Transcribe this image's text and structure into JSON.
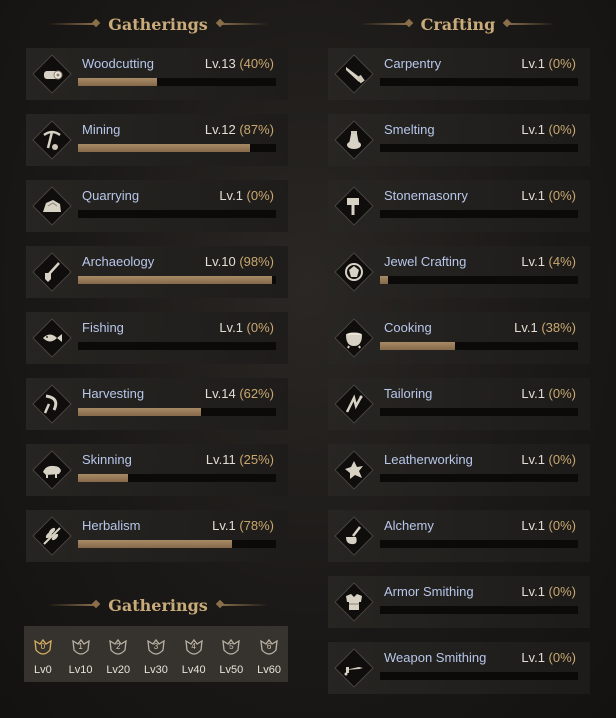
{
  "gatherings_title": "Gatherings",
  "crafting_title": "Crafting",
  "gatherings_bottom_title": "Gatherings",
  "gathering_skills": [
    {
      "name": "Woodcutting",
      "level": "Lv.13",
      "pct": "(40%)",
      "progress": 0.4,
      "icon": "log-icon"
    },
    {
      "name": "Mining",
      "level": "Lv.12",
      "pct": "(87%)",
      "progress": 0.87,
      "icon": "pickaxe-icon"
    },
    {
      "name": "Quarrying",
      "level": "Lv.1",
      "pct": "(0%)",
      "progress": 0.0,
      "icon": "stone-icon"
    },
    {
      "name": "Archaeology",
      "level": "Lv.10",
      "pct": "(98%)",
      "progress": 0.98,
      "icon": "shovel-icon"
    },
    {
      "name": "Fishing",
      "level": "Lv.1",
      "pct": "(0%)",
      "progress": 0.0,
      "icon": "fish-icon"
    },
    {
      "name": "Harvesting",
      "level": "Lv.14",
      "pct": "(62%)",
      "progress": 0.62,
      "icon": "sickle-icon"
    },
    {
      "name": "Skinning",
      "level": "Lv.11",
      "pct": "(25%)",
      "progress": 0.25,
      "icon": "boar-icon"
    },
    {
      "name": "Herbalism",
      "level": "Lv.1",
      "pct": "(78%)",
      "progress": 0.78,
      "icon": "herb-icon"
    }
  ],
  "crafting_skills": [
    {
      "name": "Carpentry",
      "level": "Lv.1",
      "pct": "(0%)",
      "progress": 0.0,
      "icon": "saw-icon"
    },
    {
      "name": "Smelting",
      "level": "Lv.1",
      "pct": "(0%)",
      "progress": 0.0,
      "icon": "furnace-icon"
    },
    {
      "name": "Stonemasonry",
      "level": "Lv.1",
      "pct": "(0%)",
      "progress": 0.0,
      "icon": "hammer-icon"
    },
    {
      "name": "Jewel Crafting",
      "level": "Lv.1",
      "pct": "(4%)",
      "progress": 0.04,
      "icon": "gem-icon"
    },
    {
      "name": "Cooking",
      "level": "Lv.1",
      "pct": "(38%)",
      "progress": 0.38,
      "icon": "pot-icon"
    },
    {
      "name": "Tailoring",
      "level": "Lv.1",
      "pct": "(0%)",
      "progress": 0.0,
      "icon": "needle-icon"
    },
    {
      "name": "Leatherworking",
      "level": "Lv.1",
      "pct": "(0%)",
      "progress": 0.0,
      "icon": "hide-icon"
    },
    {
      "name": "Alchemy",
      "level": "Lv.1",
      "pct": "(0%)",
      "progress": 0.0,
      "icon": "flask-icon"
    },
    {
      "name": "Armor Smithing",
      "level": "Lv.1",
      "pct": "(0%)",
      "progress": 0.0,
      "icon": "armor-icon"
    },
    {
      "name": "Weapon Smithing",
      "level": "Lv.1",
      "pct": "(0%)",
      "progress": 0.0,
      "icon": "sword-icon"
    }
  ],
  "tiers": [
    {
      "badge": "0",
      "label": "Lv0",
      "active": true
    },
    {
      "badge": "1",
      "label": "Lv10",
      "active": false
    },
    {
      "badge": "2",
      "label": "Lv20",
      "active": false
    },
    {
      "badge": "3",
      "label": "Lv30",
      "active": false
    },
    {
      "badge": "4",
      "label": "Lv40",
      "active": false
    },
    {
      "badge": "5",
      "label": "Lv50",
      "active": false
    },
    {
      "badge": "6",
      "label": "Lv60",
      "active": false
    }
  ],
  "colors": {
    "accent_gold": "#c9ab7a",
    "skill_name": "#b7c7ea",
    "bar_fill": "#a88a66"
  }
}
